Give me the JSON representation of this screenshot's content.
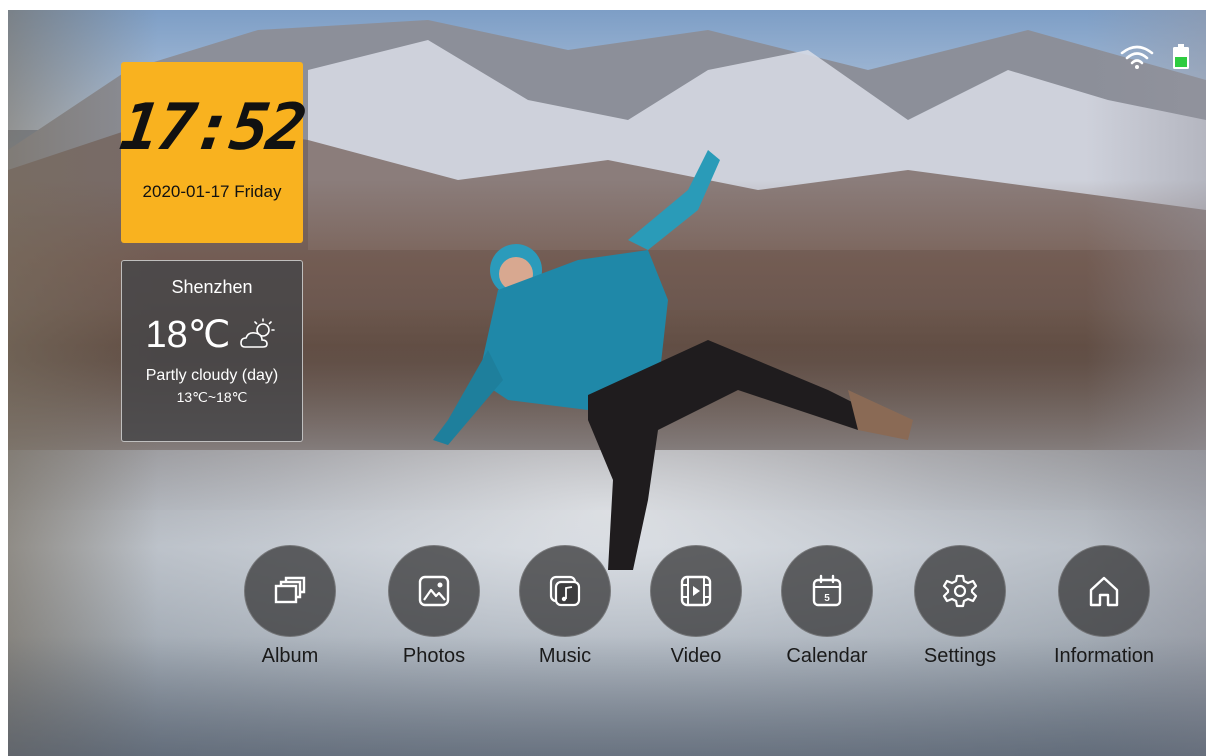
{
  "status_bar": {
    "wifi_icon": "wifi-icon",
    "battery_icon": "battery-icon",
    "battery_color": "#2ecc40"
  },
  "clock": {
    "time": "17:52",
    "date": "2020-01-17 Friday",
    "background": "#f9b21f"
  },
  "weather": {
    "city": "Shenzhen",
    "temperature": "18℃",
    "icon": "partly-cloudy-icon",
    "condition": "Partly cloudy (day)",
    "range": "13℃~18℃"
  },
  "dock": {
    "items": [
      {
        "label": "Album",
        "icon": "album-icon"
      },
      {
        "label": "Photos",
        "icon": "photos-icon"
      },
      {
        "label": "Music",
        "icon": "music-icon"
      },
      {
        "label": "Video",
        "icon": "video-icon"
      },
      {
        "label": "Calendar",
        "icon": "calendar-icon",
        "icon_digit": "5"
      },
      {
        "label": "Settings",
        "icon": "settings-icon"
      },
      {
        "label": "Information",
        "icon": "home-icon"
      }
    ]
  }
}
